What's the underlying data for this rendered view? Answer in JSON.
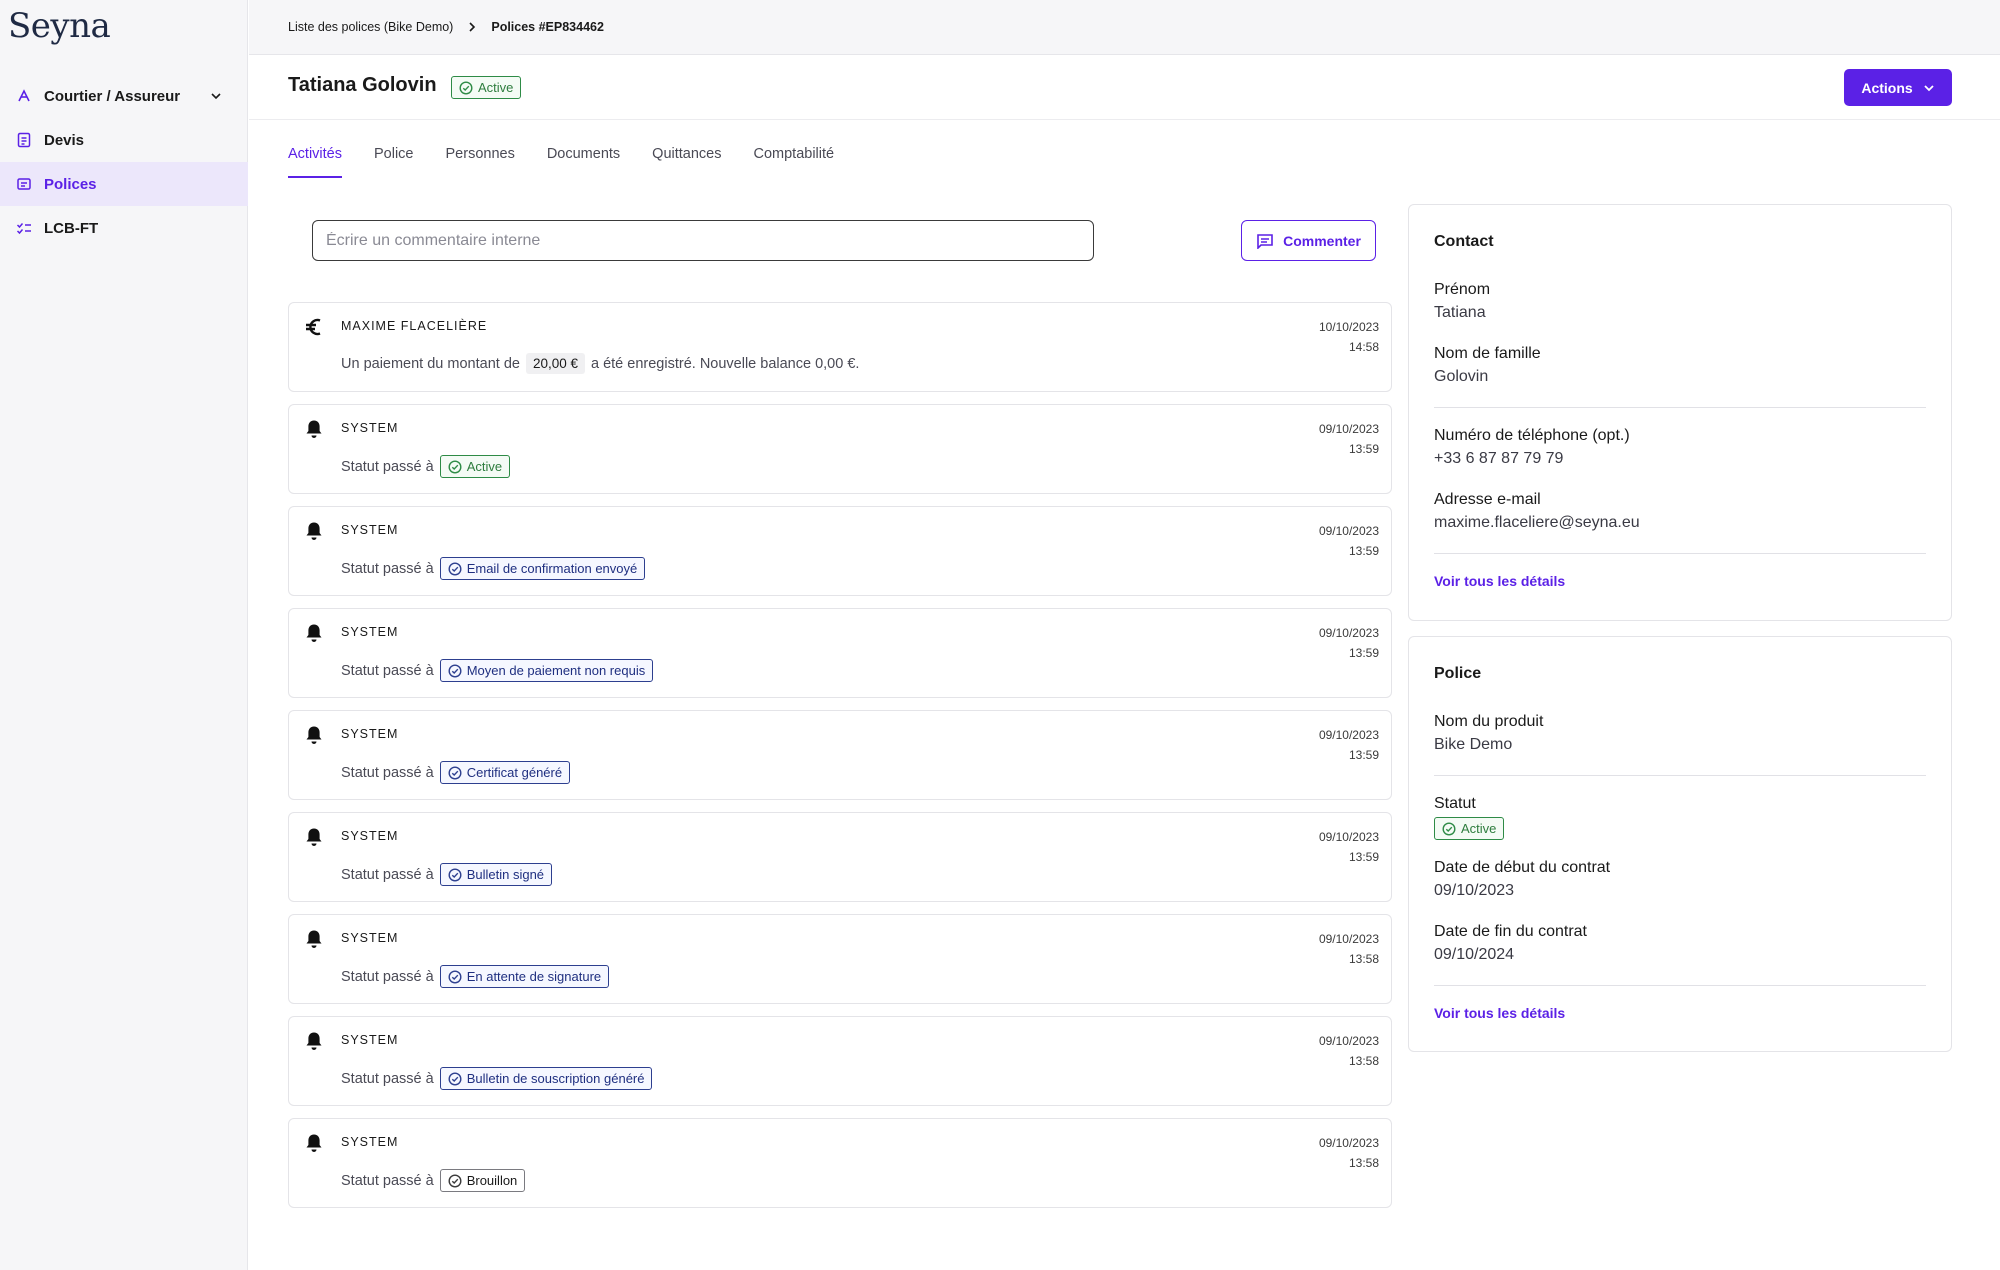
{
  "app": {
    "logo": "Seyna"
  },
  "sidebar": {
    "items": [
      {
        "label": "Courtier / Assureur",
        "icon": "broker-icon"
      },
      {
        "label": "Devis",
        "icon": "quote-document-icon"
      },
      {
        "label": "Polices",
        "icon": "policy-icon",
        "active": true
      },
      {
        "label": "LCB-FT",
        "icon": "checklist-icon"
      }
    ]
  },
  "breadcrumb": {
    "parent": "Liste des polices (Bike Demo)",
    "current": "Polices #EP834462"
  },
  "header": {
    "name": "Tatiana Golovin",
    "status": "Active",
    "actions_label": "Actions"
  },
  "tabs": [
    "Activités",
    "Police",
    "Personnes",
    "Documents",
    "Quittances",
    "Comptabilité"
  ],
  "comment": {
    "placeholder": "Écrire un commentaire interne",
    "button_label": "Commenter"
  },
  "activities": [
    {
      "author": "MAXIME FLACELIÈRE",
      "date": "10/10/2023",
      "time": "14:58",
      "icon": "euro-icon",
      "text_before": "Un paiement du montant de",
      "amount": "20,00 €",
      "text_after": "a été enregistré. Nouvelle balance 0,00 €."
    },
    {
      "author": "SYSTEM",
      "date": "09/10/2023",
      "time": "13:59",
      "icon": "bell-icon",
      "prefix": "Statut passé à",
      "status": "Active",
      "style": "green"
    },
    {
      "author": "SYSTEM",
      "date": "09/10/2023",
      "time": "13:59",
      "icon": "bell-icon",
      "prefix": "Statut passé à",
      "status": "Email de confirmation envoyé",
      "style": "blue"
    },
    {
      "author": "SYSTEM",
      "date": "09/10/2023",
      "time": "13:59",
      "icon": "bell-icon",
      "prefix": "Statut passé à",
      "status": "Moyen de paiement non requis",
      "style": "blue"
    },
    {
      "author": "SYSTEM",
      "date": "09/10/2023",
      "time": "13:59",
      "icon": "bell-icon",
      "prefix": "Statut passé à",
      "status": "Certificat généré",
      "style": "blue"
    },
    {
      "author": "SYSTEM",
      "date": "09/10/2023",
      "time": "13:59",
      "icon": "bell-icon",
      "prefix": "Statut passé à",
      "status": "Bulletin signé",
      "style": "blue"
    },
    {
      "author": "SYSTEM",
      "date": "09/10/2023",
      "time": "13:58",
      "icon": "bell-icon",
      "prefix": "Statut passé à",
      "status": "En attente de signature",
      "style": "blue"
    },
    {
      "author": "SYSTEM",
      "date": "09/10/2023",
      "time": "13:58",
      "icon": "bell-icon",
      "prefix": "Statut passé à",
      "status": "Bulletin de souscription généré",
      "style": "blue"
    },
    {
      "author": "SYSTEM",
      "date": "09/10/2023",
      "time": "13:58",
      "icon": "bell-icon",
      "prefix": "Statut passé à",
      "status": "Brouillon",
      "style": "gray"
    }
  ],
  "contact": {
    "title": "Contact",
    "first_name_label": "Prénom",
    "first_name": "Tatiana",
    "last_name_label": "Nom de famille",
    "last_name": "Golovin",
    "phone_label": "Numéro de téléphone (opt.)",
    "phone": "+33 6 87 87 79 79",
    "email_label": "Adresse e-mail",
    "email": "maxime.flaceliere@seyna.eu",
    "details_link": "Voir tous les détails"
  },
  "police": {
    "title": "Police",
    "product_label": "Nom du produit",
    "product": "Bike Demo",
    "status_label": "Statut",
    "status": "Active",
    "start_label": "Date de début du contrat",
    "start": "09/10/2023",
    "end_label": "Date de fin du contrat",
    "end": "09/10/2024",
    "details_link": "Voir tous les détails"
  },
  "colors": {
    "accent": "#5b21e6",
    "status_green": "#2e8b46",
    "status_blue": "#2d3f8f"
  }
}
